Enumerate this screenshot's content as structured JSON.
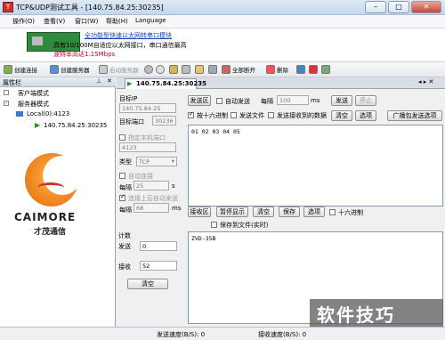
{
  "window": {
    "title": "TCP&UDP测试工具 - [140.75.84.25:30235]"
  },
  "menu": [
    "操作(O)",
    "查看(V)",
    "窗口(W)",
    "帮助(H)",
    "Language"
  ],
  "ad": {
    "line1": "全功能型快速以太网转串口模块",
    "line2": "具有10/100M自适应以太网接口，串口通信最高",
    "line3": "波特率高达1.15Mbps"
  },
  "toolbar": [
    "创建连接",
    "创建服务器",
    "启动服务器",
    "全部断开",
    "删除"
  ],
  "sidebar": {
    "title": "属性栏",
    "tree": [
      "客户端模式",
      "服务器模式",
      "Local(0):4123",
      "140.75.84.25:30235"
    ],
    "logo_text": "CAIMORE",
    "logo_sub": "才茂通信"
  },
  "tab": {
    "label": "140.75.84.25:30235"
  },
  "left_form": {
    "target_ip_label": "目标IP",
    "target_ip": "140.75.84.25",
    "target_port_label": "目标端口",
    "target_port": "30236",
    "local_port_chk": "指定本机端口",
    "local_port": "4123",
    "type_label": "类型",
    "type_value": "TCP",
    "auto_connect": "自动连接",
    "interval_label": "每隔",
    "interval1": "25",
    "interval_unit": "s",
    "auto_send_after": "连接上后自动发送",
    "interval2": "68",
    "interval2_unit": "ms",
    "count_label": "计数",
    "send_label": "发送",
    "send_count": "0",
    "recv_label": "接收",
    "recv_count": "52",
    "clear_label": "清空"
  },
  "send_area": {
    "title": "发送区",
    "auto_send": "自动发送",
    "interval_label": "每隔",
    "interval": "100",
    "unit": "ms",
    "send_btn": "发送",
    "stop_btn": "停止",
    "hex": "按十六进制",
    "send_file": "发送文件",
    "send_received": "发送接收到的数据",
    "clear_btn": "清空",
    "options_btn": "选项",
    "broadcast_btn": "广播包发送选项",
    "content": "01 02 03 04 05"
  },
  "recv_area": {
    "title": "接收区",
    "pause_btn": "暂停显示",
    "clear_btn": "清空",
    "save_btn": "保存",
    "options_btn": "选项",
    "hex": "十六进制",
    "save_to_file": "保存到文件(实时)",
    "content": "ZVD-35B"
  },
  "status": {
    "send_speed": "发送速度(B/S): 0",
    "recv_speed": "接收速度(B/S): 0"
  },
  "watermark": "软件技巧"
}
